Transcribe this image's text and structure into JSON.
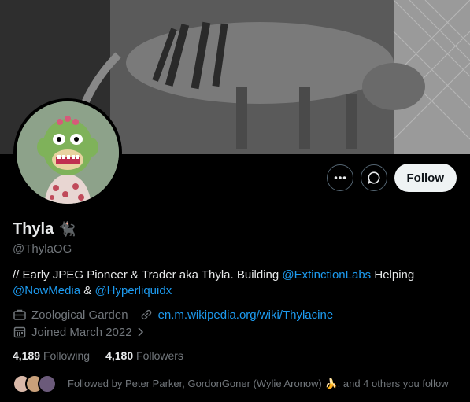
{
  "profile": {
    "display_name": "Thyla",
    "name_emoji": "🐈‍⬛",
    "handle": "@ThylaOG",
    "bio": {
      "text_1": "// Early JPEG Pioneer & Trader aka Thyla. Building ",
      "mention_1": "@ExtinctionLabs",
      "text_2": " Helping ",
      "mention_2": "@NowMedia",
      "text_3": " & ",
      "mention_3": "@Hyperliquidx"
    },
    "work": "Zoological Garden",
    "website": "en.m.wikipedia.org/wiki/Thylacine",
    "joined": "Joined March 2022"
  },
  "actions": {
    "more_icon": "more-icon",
    "message_icon": "message-icon",
    "follow_label": "Follow"
  },
  "stats": {
    "following_count": "4,189",
    "following_label": "Following",
    "followers_count": "4,180",
    "followers_label": "Followers"
  },
  "followed_by": {
    "text": "Followed by Peter Parker, GordonGoner (Wylie Aronow) 🍌, and 4 others you follow"
  },
  "colors": {
    "background": "#000000",
    "link": "#1d9bf0",
    "muted": "#71767b",
    "text": "#e7e9ea",
    "follow_button": "#eff3f4"
  }
}
